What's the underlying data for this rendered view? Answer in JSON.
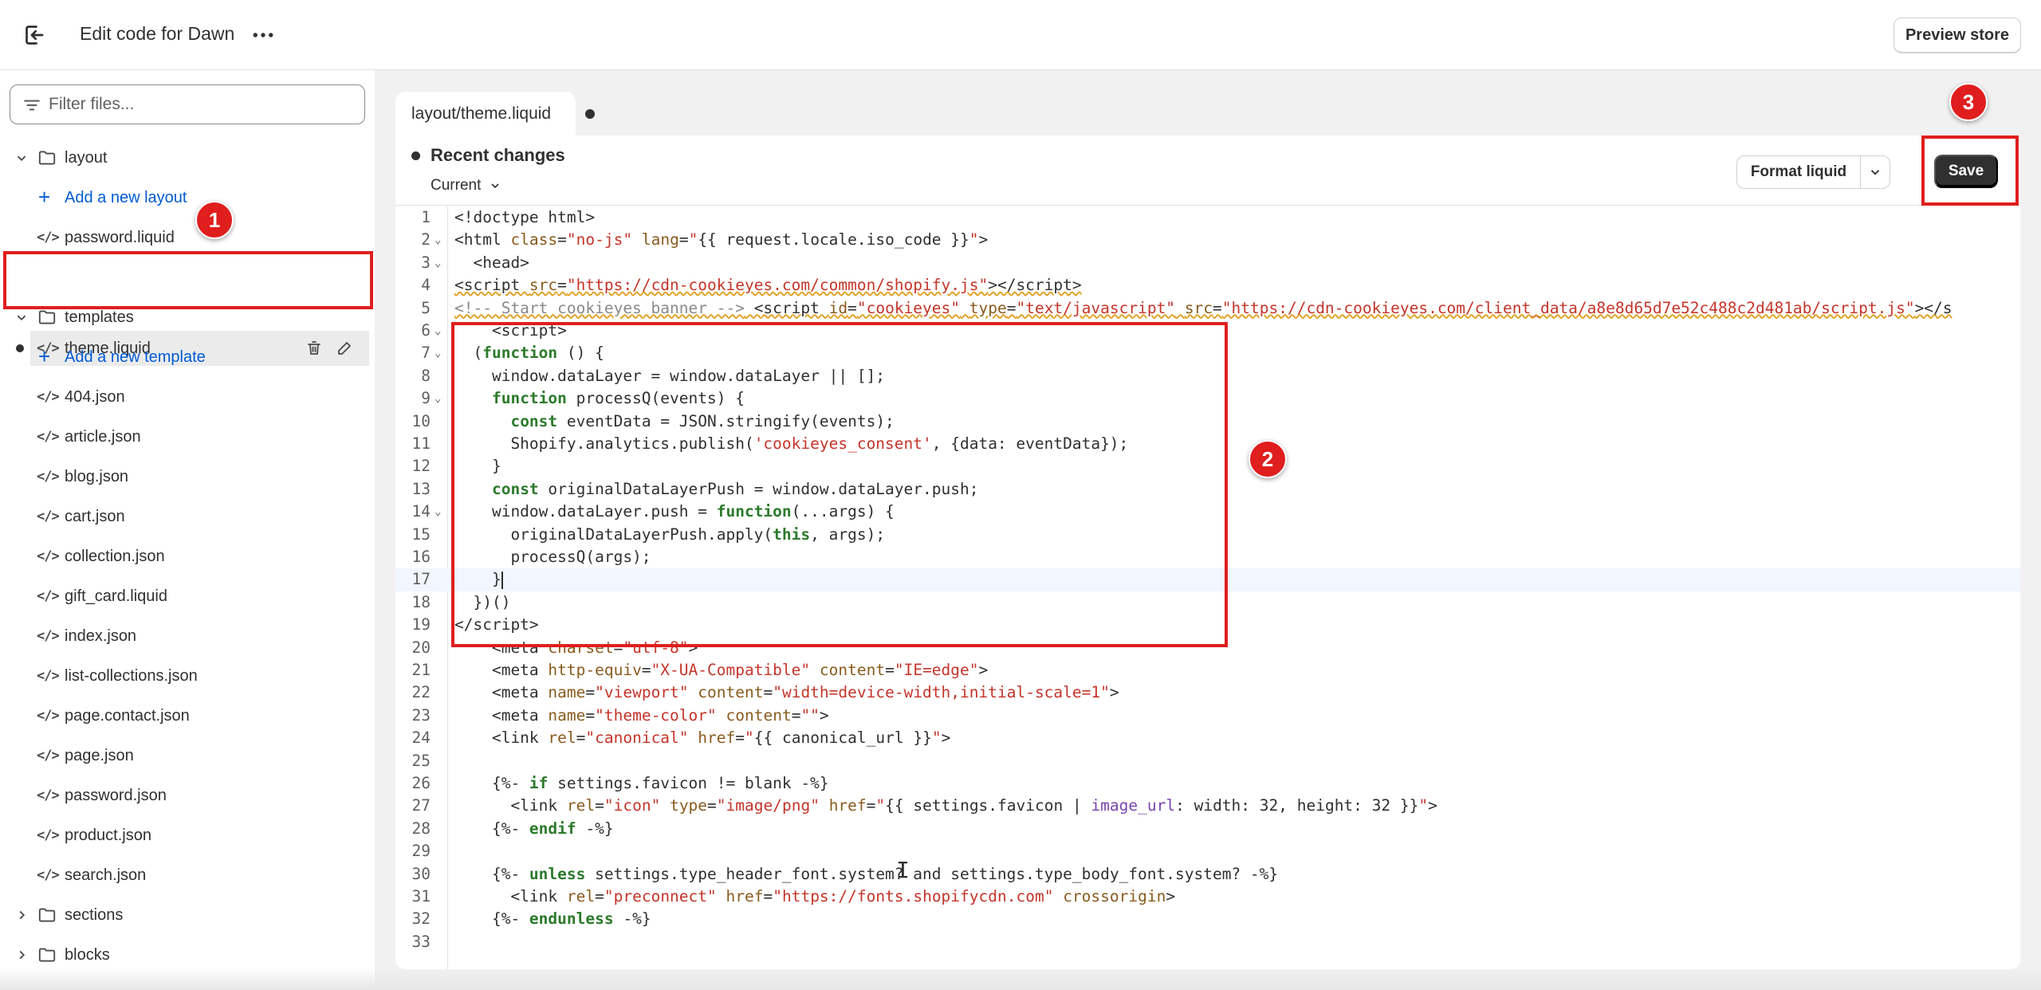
{
  "topbar": {
    "title": "Edit code for Dawn",
    "more": "⋯",
    "preview_label": "Preview store"
  },
  "sidebar": {
    "filter_placeholder": "Filter files...",
    "rows": [
      {
        "kind": "folder",
        "label": "layout",
        "expanded": true
      },
      {
        "kind": "add",
        "label": "Add a new layout"
      },
      {
        "kind": "file",
        "label": "password.liquid"
      },
      {
        "kind": "file",
        "label": "theme.liquid",
        "active": true
      },
      {
        "kind": "folder",
        "label": "templates",
        "expanded": true
      },
      {
        "kind": "add",
        "label": "Add a new template"
      },
      {
        "kind": "file",
        "label": "404.json"
      },
      {
        "kind": "file",
        "label": "article.json"
      },
      {
        "kind": "file",
        "label": "blog.json"
      },
      {
        "kind": "file",
        "label": "cart.json"
      },
      {
        "kind": "file",
        "label": "collection.json"
      },
      {
        "kind": "file",
        "label": "gift_card.liquid"
      },
      {
        "kind": "file",
        "label": "index.json"
      },
      {
        "kind": "file",
        "label": "list-collections.json"
      },
      {
        "kind": "file",
        "label": "page.contact.json"
      },
      {
        "kind": "file",
        "label": "page.json"
      },
      {
        "kind": "file",
        "label": "password.json"
      },
      {
        "kind": "file",
        "label": "product.json"
      },
      {
        "kind": "file",
        "label": "search.json"
      },
      {
        "kind": "folder",
        "label": "sections",
        "expanded": false
      },
      {
        "kind": "folder",
        "label": "blocks",
        "expanded": false
      }
    ]
  },
  "editor": {
    "tab_dir": "layout/",
    "tab_file": "theme.liquid",
    "recent_changes": "Recent changes",
    "current_label": "Current",
    "format_label": "Format liquid",
    "save_label": "Save"
  },
  "code_lines": [
    "1",
    "2",
    "3",
    "4",
    "5",
    "6",
    "7",
    "8",
    "9",
    "10",
    "11",
    "12",
    "13",
    "14",
    "15",
    "16",
    "17",
    "18",
    "19",
    "20",
    "21",
    "22",
    "23",
    "24",
    "25",
    "26",
    "27",
    "28",
    "29",
    "30",
    "31",
    "32",
    "33"
  ],
  "annotations": {
    "badge1": "1",
    "badge2": "2",
    "badge3": "3",
    "color": "#e01e1e"
  }
}
